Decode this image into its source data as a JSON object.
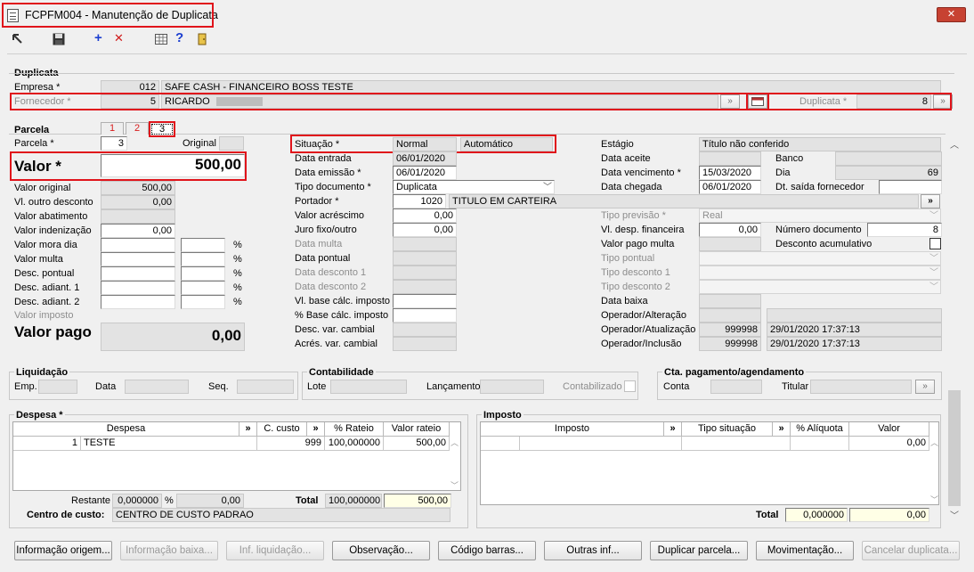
{
  "window": {
    "title": "FCPFM004 - Manutenção de Duplicata",
    "close": "✕"
  },
  "toolbar": {
    "add": "+",
    "remove": "✕",
    "help": "?"
  },
  "duplicata": {
    "section": "Duplicata",
    "empresa_label": "Empresa *",
    "empresa_code": "012",
    "empresa_name": "SAFE CASH - FINANCEIRO BOSS TESTE",
    "fornecedor_label": "Fornecedor *",
    "fornecedor_code": "5",
    "fornecedor_name": "RICARDO",
    "dup_label": "Duplicata *",
    "dup_value": "8"
  },
  "parcela": {
    "section": "Parcela",
    "tabs": [
      "1",
      "2",
      "3"
    ],
    "parcela_label": "Parcela *",
    "parcela_value": "3",
    "original_label": "Original",
    "valor_label": "Valor *",
    "valor_value": "500,00",
    "rows": [
      {
        "label": "Valor original",
        "value": "500,00",
        "ro": true
      },
      {
        "label": "Vl. outro desconto",
        "value": "0,00",
        "ro": true
      },
      {
        "label": "Valor abatimento",
        "value": "",
        "ro": true
      },
      {
        "label": "Valor indenização",
        "value": "0,00",
        "ro": false
      },
      {
        "label": "Valor mora dia",
        "value": "",
        "pct": true
      },
      {
        "label": "Valor multa",
        "value": "",
        "pct": true
      },
      {
        "label": "Desc. pontual",
        "value": "",
        "pct": true
      },
      {
        "label": "Desc. adiant. 1",
        "value": "",
        "pct": true
      },
      {
        "label": "Desc. adiant. 2",
        "value": "",
        "pct": true
      }
    ],
    "pct_symbol": "%",
    "valor_imposto_label": "Valor imposto",
    "valor_pago_label": "Valor pago",
    "valor_pago_value": "0,00"
  },
  "middle": {
    "situacao_label": "Situação *",
    "situacao_value": "Normal",
    "situacao_auto": "Automático",
    "data_entrada_label": "Data entrada",
    "data_entrada": "06/01/2020",
    "data_emissao_label": "Data emissão *",
    "data_emissao": "06/01/2020",
    "tipo_doc_label": "Tipo documento *",
    "tipo_doc": "Duplicata",
    "portador_label": "Portador *",
    "portador_code": "1020",
    "portador_name": "TITULO EM CARTEIRA",
    "valor_acrescimo_label": "Valor acréscimo",
    "valor_acrescimo": "0,00",
    "juro_label": "Juro fixo/outro",
    "juro": "0,00",
    "data_multa_label": "Data multa",
    "data_pontual_label": "Data pontual",
    "data_desc1_label": "Data desconto 1",
    "data_desc2_label": "Data desconto 2",
    "vl_base_label": "Vl. base cálc. imposto",
    "pct_base_label": "% Base cálc. imposto",
    "desc_var_label": "Desc. var. cambial",
    "acres_var_label": "Acrés. var. cambial"
  },
  "right": {
    "estagio_label": "Estágio",
    "estagio_value": "Título não conferido",
    "data_aceite_label": "Data aceite",
    "banco_label": "Banco",
    "data_venc_label": "Data vencimento *",
    "data_venc": "15/03/2020",
    "dia_label": "Dia",
    "dia_value": "69",
    "data_chegada_label": "Data chegada",
    "data_chegada": "06/01/2020",
    "dt_saida_label": "Dt. saída fornecedor",
    "tipo_previsao_label": "Tipo previsão *",
    "tipo_previsao": "Real",
    "vl_desp_label": "Vl. desp. financeira",
    "vl_desp": "0,00",
    "num_doc_label": "Número documento",
    "num_doc": "8",
    "valor_pago_multa_label": "Valor pago multa",
    "desc_acum_label": "Desconto acumulativo",
    "tipo_pontual_label": "Tipo pontual",
    "tipo_desc1_label": "Tipo desconto 1",
    "tipo_desc2_label": "Tipo desconto 2",
    "data_baixa_label": "Data baixa",
    "op_alt_label": "Operador/Alteração",
    "op_atu_label": "Operador/Atualização",
    "op_atu_code": "999998",
    "op_atu_date": "29/01/2020 17:37:13",
    "op_inc_label": "Operador/Inclusão",
    "op_inc_code": "999998",
    "op_inc_date": "29/01/2020 17:37:13"
  },
  "liquidacao": {
    "title": "Liquidação",
    "emp": "Emp.",
    "data": "Data",
    "seq": "Seq."
  },
  "contabilidade": {
    "title": "Contabilidade",
    "lote": "Lote",
    "lancamento": "Lançamento",
    "contabilizado": "Contabilizado"
  },
  "cta": {
    "title": "Cta. pagamento/agendamento",
    "conta": "Conta",
    "titular": "Titular"
  },
  "despesa": {
    "title": "Despesa *",
    "headers": [
      "Despesa",
      "»",
      "C. custo",
      "»",
      "% Rateio",
      "Valor rateio"
    ],
    "row": {
      "num": "1",
      "name": "TESTE",
      "ccusto": "999",
      "rateio": "100,000000",
      "valor": "500,00"
    },
    "restante_label": "Restante",
    "restante_pct": "0,000000",
    "restante_sym": "%",
    "restante_val": "0,00",
    "total_label": "Total",
    "total_pct": "100,000000",
    "total_val": "500,00",
    "centro_label": "Centro de custo:",
    "centro_value": "CENTRO DE CUSTO PADRAO"
  },
  "imposto": {
    "title": "Imposto",
    "headers": [
      "Imposto",
      "»",
      "Tipo situação",
      "»",
      "% Alíquota",
      "Valor"
    ],
    "row_valor": "0,00",
    "total_label": "Total",
    "total_pct": "0,000000",
    "total_val": "0,00"
  },
  "buttons": [
    {
      "label": "Informação origem...",
      "enabled": true
    },
    {
      "label": "Informação baixa...",
      "enabled": false
    },
    {
      "label": "Inf. liquidação...",
      "enabled": false
    },
    {
      "label": "Observação...",
      "enabled": true
    },
    {
      "label": "Código barras...",
      "enabled": true
    },
    {
      "label": "Outras inf...",
      "enabled": true
    },
    {
      "label": "Duplicar parcela...",
      "enabled": true
    },
    {
      "label": "Movimentação...",
      "enabled": true
    },
    {
      "label": "Cancelar duplicata...",
      "enabled": false
    }
  ],
  "colors": {
    "highlight": "#e0141b",
    "close_button": "#c74232"
  }
}
